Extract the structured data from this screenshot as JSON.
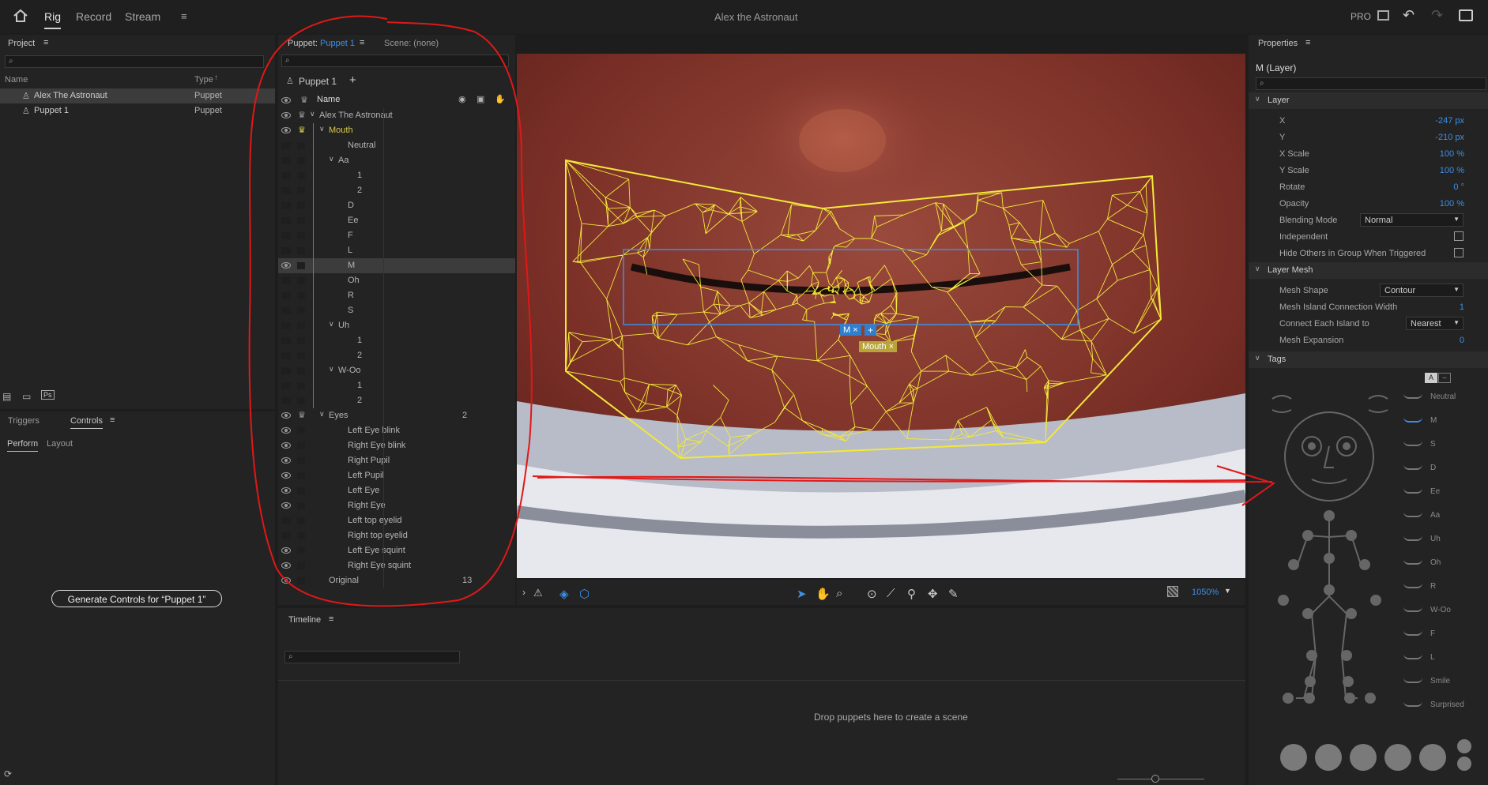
{
  "app": {
    "title": "Alex the Astronaut",
    "pro_label": "PRO"
  },
  "top_tabs": [
    "Rig",
    "Record",
    "Stream"
  ],
  "project": {
    "header": "Project",
    "columns": {
      "name": "Name",
      "type": "Type"
    },
    "items": [
      {
        "name": "Alex The Astronaut",
        "type": "Puppet"
      },
      {
        "name": "Puppet 1",
        "type": "Puppet"
      }
    ],
    "ps_label": "Ps"
  },
  "controls": {
    "tabs": [
      "Triggers",
      "Controls"
    ],
    "subtabs": [
      "Perform",
      "Layout"
    ],
    "generate_button": "Generate Controls for “Puppet 1”"
  },
  "puppet_panel": {
    "tab_prefix": "Puppet:",
    "tab_name": "Puppet 1",
    "scene_tab": "Scene: (none)",
    "breadcrumb": "Puppet 1",
    "name_header": "Name",
    "rows": [
      {
        "label": "Alex The Astronaut",
        "indent": 0,
        "arrow": true,
        "eye": true,
        "crown": true,
        "count": ""
      },
      {
        "label": "Mouth",
        "indent": 1,
        "arrow": true,
        "eye": true,
        "crown": true,
        "count": "",
        "highlight": true
      },
      {
        "label": "Neutral",
        "indent": 3,
        "arrow": false,
        "eye": false,
        "crown": false,
        "count": ""
      },
      {
        "label": "Aa",
        "indent": 2,
        "arrow": true,
        "eye": false,
        "crown": false,
        "count": ""
      },
      {
        "label": "1",
        "indent": 4,
        "arrow": false,
        "eye": false,
        "crown": false,
        "count": ""
      },
      {
        "label": "2",
        "indent": 4,
        "arrow": false,
        "eye": false,
        "crown": false,
        "count": ""
      },
      {
        "label": "D",
        "indent": 3,
        "arrow": false,
        "eye": false,
        "crown": false,
        "count": ""
      },
      {
        "label": "Ee",
        "indent": 3,
        "arrow": false,
        "eye": false,
        "crown": false,
        "count": ""
      },
      {
        "label": "F",
        "indent": 3,
        "arrow": false,
        "eye": false,
        "crown": false,
        "count": ""
      },
      {
        "label": "L",
        "indent": 3,
        "arrow": false,
        "eye": false,
        "crown": false,
        "count": ""
      },
      {
        "label": "M",
        "indent": 3,
        "arrow": false,
        "eye": true,
        "crown": false,
        "count": "",
        "selected": true
      },
      {
        "label": "Oh",
        "indent": 3,
        "arrow": false,
        "eye": false,
        "crown": false,
        "count": ""
      },
      {
        "label": "R",
        "indent": 3,
        "arrow": false,
        "eye": false,
        "crown": false,
        "count": ""
      },
      {
        "label": "S",
        "indent": 3,
        "arrow": false,
        "eye": false,
        "crown": false,
        "count": ""
      },
      {
        "label": "Uh",
        "indent": 2,
        "arrow": true,
        "eye": false,
        "crown": false,
        "count": ""
      },
      {
        "label": "1",
        "indent": 4,
        "arrow": false,
        "eye": false,
        "crown": false,
        "count": ""
      },
      {
        "label": "2",
        "indent": 4,
        "arrow": false,
        "eye": false,
        "crown": false,
        "count": ""
      },
      {
        "label": "W-Oo",
        "indent": 2,
        "arrow": true,
        "eye": false,
        "crown": false,
        "count": ""
      },
      {
        "label": "1",
        "indent": 4,
        "arrow": false,
        "eye": false,
        "crown": false,
        "count": ""
      },
      {
        "label": "2",
        "indent": 4,
        "arrow": false,
        "eye": false,
        "crown": false,
        "count": ""
      },
      {
        "label": "Eyes",
        "indent": 1,
        "arrow": true,
        "eye": true,
        "crown": true,
        "count": "2"
      },
      {
        "label": "Left Eye blink",
        "indent": 3,
        "arrow": false,
        "eye": true,
        "crown": false,
        "count": ""
      },
      {
        "label": "Right Eye blink",
        "indent": 3,
        "arrow": false,
        "eye": true,
        "crown": false,
        "count": ""
      },
      {
        "label": "Right Pupil",
        "indent": 3,
        "arrow": false,
        "eye": true,
        "crown": false,
        "count": ""
      },
      {
        "label": "Left Pupil",
        "indent": 3,
        "arrow": false,
        "eye": true,
        "crown": false,
        "count": ""
      },
      {
        "label": "Left Eye",
        "indent": 3,
        "arrow": false,
        "eye": true,
        "crown": false,
        "count": ""
      },
      {
        "label": "Right Eye",
        "indent": 3,
        "arrow": false,
        "eye": true,
        "crown": false,
        "count": ""
      },
      {
        "label": "Left top eyelid",
        "indent": 3,
        "arrow": false,
        "eye": false,
        "crown": false,
        "count": ""
      },
      {
        "label": "Right top eyelid",
        "indent": 3,
        "arrow": false,
        "eye": false,
        "crown": false,
        "count": ""
      },
      {
        "label": "Left Eye squint",
        "indent": 3,
        "arrow": false,
        "eye": true,
        "crown": false,
        "count": ""
      },
      {
        "label": "Right Eye squint",
        "indent": 3,
        "arrow": false,
        "eye": true,
        "crown": false,
        "count": ""
      },
      {
        "label": "Original",
        "indent": 1,
        "arrow": false,
        "eye": true,
        "crown": false,
        "count": "13"
      }
    ]
  },
  "viewer": {
    "zoom": "1050%",
    "handle_m": "M",
    "handle_mouth": "Mouth"
  },
  "timeline": {
    "header": "Timeline",
    "empty_message": "Drop puppets here to create a scene"
  },
  "properties": {
    "header": "Properties",
    "layer_title": "M (Layer)",
    "layer_section": "Layer",
    "layer_props": [
      {
        "label": "X",
        "value": "-247 px"
      },
      {
        "label": "Y",
        "value": "-210 px"
      },
      {
        "label": "X Scale",
        "value": "100 %"
      },
      {
        "label": "Y Scale",
        "value": "100 %"
      },
      {
        "label": "Rotate",
        "value": "0 °"
      },
      {
        "label": "Opacity",
        "value": "100 %"
      }
    ],
    "blending_label": "Blending Mode",
    "blending_value": "Normal",
    "independent_label": "Independent",
    "hide_others_label": "Hide Others in Group When Triggered",
    "mesh_section": "Layer Mesh",
    "mesh_shape_label": "Mesh Shape",
    "mesh_shape_value": "Contour",
    "island_width_label": "Mesh Island Connection Width",
    "island_width_value": "1",
    "connect_label": "Connect Each Island to",
    "connect_value": "Nearest",
    "expansion_label": "Mesh Expansion",
    "expansion_value": "0",
    "tags_section": "Tags",
    "tag_toggle_a": "A",
    "tags": [
      "Neutral",
      "M",
      "S",
      "D",
      "Ee",
      "Aa",
      "Uh",
      "Oh",
      "R",
      "W-Oo",
      "F",
      "L",
      "Smile",
      "Surprised"
    ]
  },
  "colors": {
    "accent": "#3d8fe6",
    "mesh": "#f3e83a",
    "highlight": "#d7c84a",
    "annotation": "#e01818"
  }
}
